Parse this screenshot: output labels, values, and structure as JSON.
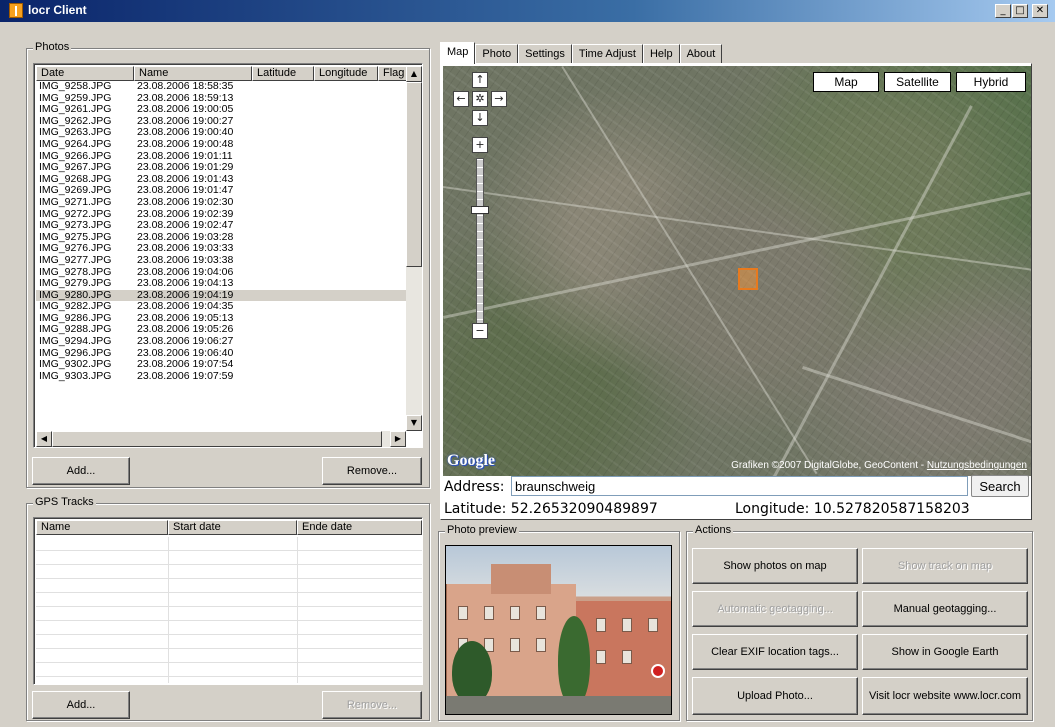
{
  "window": {
    "title": "locr Client",
    "minimize_icon": "_",
    "maximize_icon": "□",
    "close_icon": "✕"
  },
  "photos": {
    "group_label": "Photos",
    "columns": [
      "Date",
      "Name",
      "Latitude",
      "Longitude",
      "Flag"
    ],
    "rows": [
      [
        "IMG_9258.JPG",
        "23.08.2006 18:58:35"
      ],
      [
        "IMG_9259.JPG",
        "23.08.2006 18:59:13"
      ],
      [
        "IMG_9261.JPG",
        "23.08.2006 19:00:05"
      ],
      [
        "IMG_9262.JPG",
        "23.08.2006 19:00:27"
      ],
      [
        "IMG_9263.JPG",
        "23.08.2006 19:00:40"
      ],
      [
        "IMG_9264.JPG",
        "23.08.2006 19:00:48"
      ],
      [
        "IMG_9266.JPG",
        "23.08.2006 19:01:11"
      ],
      [
        "IMG_9267.JPG",
        "23.08.2006 19:01:29"
      ],
      [
        "IMG_9268.JPG",
        "23.08.2006 19:01:43"
      ],
      [
        "IMG_9269.JPG",
        "23.08.2006 19:01:47"
      ],
      [
        "IMG_9271.JPG",
        "23.08.2006 19:02:30"
      ],
      [
        "IMG_9272.JPG",
        "23.08.2006 19:02:39"
      ],
      [
        "IMG_9273.JPG",
        "23.08.2006 19:02:47"
      ],
      [
        "IMG_9275.JPG",
        "23.08.2006 19:03:28"
      ],
      [
        "IMG_9276.JPG",
        "23.08.2006 19:03:33"
      ],
      [
        "IMG_9277.JPG",
        "23.08.2006 19:03:38"
      ],
      [
        "IMG_9278.JPG",
        "23.08.2006 19:04:06"
      ],
      [
        "IMG_9279.JPG",
        "23.08.2006 19:04:13"
      ],
      [
        "IMG_9280.JPG",
        "23.08.2006 19:04:19"
      ],
      [
        "IMG_9282.JPG",
        "23.08.2006 19:04:35"
      ],
      [
        "IMG_9286.JPG",
        "23.08.2006 19:05:13"
      ],
      [
        "IMG_9288.JPG",
        "23.08.2006 19:05:26"
      ],
      [
        "IMG_9294.JPG",
        "23.08.2006 19:06:27"
      ],
      [
        "IMG_9296.JPG",
        "23.08.2006 19:06:40"
      ],
      [
        "IMG_9302.JPG",
        "23.08.2006 19:07:54"
      ],
      [
        "IMG_9303.JPG",
        "23.08.2006 19:07:59"
      ]
    ],
    "selected_index": 18,
    "add_label": "Add...",
    "remove_label": "Remove..."
  },
  "gps": {
    "group_label": "GPS Tracks",
    "columns": [
      "Name",
      "Start date",
      "Ende date"
    ],
    "add_label": "Add...",
    "remove_label": "Remove..."
  },
  "tabs": [
    "Map",
    "Photo",
    "Settings",
    "Time Adjust",
    "Help",
    "About"
  ],
  "active_tab": 0,
  "map": {
    "type_buttons": [
      "Map",
      "Satellite",
      "Hybrid"
    ],
    "nav_up": "↑",
    "nav_down": "↓",
    "nav_left": "←",
    "nav_right": "→",
    "nav_center": "✲",
    "zoom_in": "+",
    "zoom_out": "−",
    "google_logo": "Google",
    "attribution": "Grafiken ©2007 DigitalGlobe, GeoContent -",
    "attribution_link": "Nutzungsbedingungen"
  },
  "address": {
    "label": "Address:",
    "value": "braunschweig",
    "search_label": "Search",
    "latitude_text": "Latitude: 52.26532090489897",
    "longitude_text": "Longitude: 10.527820587158203"
  },
  "preview": {
    "group_label": "Photo preview"
  },
  "actions": {
    "group_label": "Actions",
    "buttons": [
      {
        "label": "Show photos on map",
        "enabled": true
      },
      {
        "label": "Show track on map",
        "enabled": false
      },
      {
        "label": "Automatic geotagging...",
        "enabled": false
      },
      {
        "label": "Manual geotagging...",
        "enabled": true
      },
      {
        "label": "Clear EXIF location tags...",
        "enabled": true
      },
      {
        "label": "Show in Google Earth",
        "enabled": true
      },
      {
        "label": "Upload Photo...",
        "enabled": true
      },
      {
        "label": "Visit locr website www.locr.com",
        "enabled": true
      }
    ]
  },
  "scroll": {
    "up": "▲",
    "down": "▼",
    "left": "◀",
    "right": "▶"
  }
}
